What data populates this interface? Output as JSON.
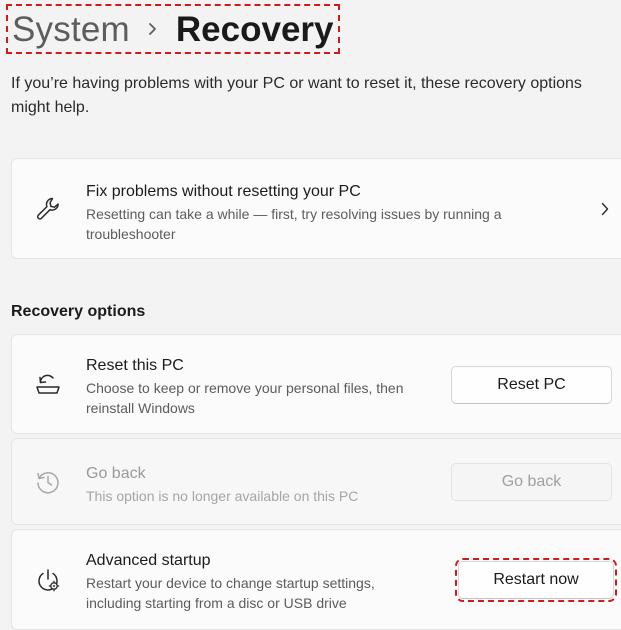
{
  "breadcrumb": {
    "parent": "System",
    "current": "Recovery"
  },
  "intro_text": "If you’re having problems with your PC or want to reset it, these recovery options might help.",
  "fix_card": {
    "title": "Fix problems without resetting your PC",
    "description": "Resetting can take a while — first, try resolving issues by running a troubleshooter",
    "icon": "wrench-icon"
  },
  "section_title": "Recovery options",
  "options": [
    {
      "title": "Reset this PC",
      "description": "Choose to keep or remove your personal files, then reinstall Windows",
      "button_label": "Reset PC",
      "icon": "reset-pc-icon",
      "enabled": true
    },
    {
      "title": "Go back",
      "description": "This option is no longer available on this PC",
      "button_label": "Go back",
      "icon": "history-icon",
      "enabled": false
    },
    {
      "title": "Advanced startup",
      "description": "Restart your device to change startup settings, including starting from a disc or USB drive",
      "button_label": "Restart now",
      "icon": "power-settings-icon",
      "enabled": true
    }
  ],
  "colors": {
    "background": "#f3f3f3",
    "card": "#fbfbfb",
    "highlight_annotation": "#d11a1a"
  }
}
